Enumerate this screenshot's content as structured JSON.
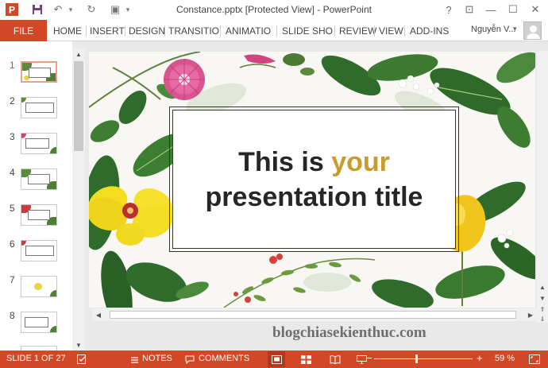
{
  "window": {
    "title": "Constance.pptx [Protected View] - PowerPoint",
    "help": "?",
    "restore_ribbon": "⊡",
    "minimize": "—",
    "maximize": "☐",
    "close": "✕"
  },
  "quick_access": {
    "save_icon": "save-icon",
    "undo": "↶",
    "undo_caret": "▾",
    "redo": "↻",
    "present": "▣",
    "customize": "▾"
  },
  "ribbon": {
    "file": "FILE",
    "tabs": [
      "HOME",
      "INSERT",
      "DESIGN",
      "TRANSITIO",
      "ANIMATIO",
      "SLIDE SHO",
      "REVIEW",
      "VIEW",
      "ADD-INS"
    ],
    "user": "Nguyễn V...",
    "user_caret": "▾"
  },
  "thumbnails": {
    "numbers": [
      "1",
      "2",
      "3",
      "4",
      "5",
      "6",
      "7",
      "8"
    ],
    "active": "1"
  },
  "slide": {
    "title_line1_prefix": "This is ",
    "title_line1_highlight": "your",
    "title_line2": "presentation title",
    "accent_color": "#c89b2a"
  },
  "scroll": {
    "up": "▲",
    "down": "▼",
    "left": "◀",
    "right": "▶",
    "page_up": "⇑",
    "page_down": "⇓"
  },
  "watermark": "blogchiasekienthuc.com",
  "status": {
    "slide_info": "SLIDE 1 OF 27",
    "notes": "NOTES",
    "comments": "COMMENTS",
    "zoom_minus": "−",
    "zoom_plus": "+",
    "zoom_level": "59 %",
    "zoom_fraction": 0.43,
    "brand_color": "#d24726"
  }
}
